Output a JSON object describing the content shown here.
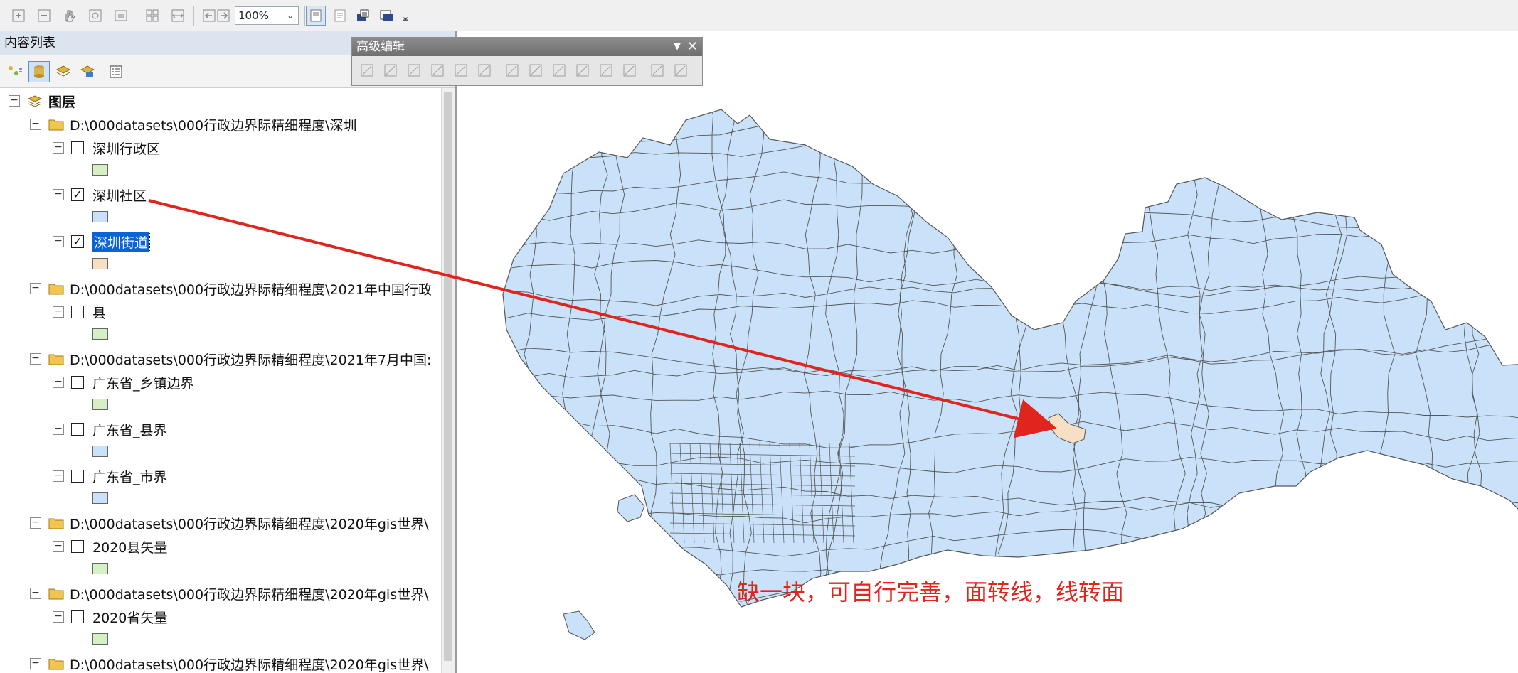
{
  "toolbar": {
    "zoom_value": "100%",
    "buttons": [
      "zoom-in-fixed-icon",
      "zoom-out-fixed-icon",
      "pan-icon",
      "full-extent-icon",
      "fixed-extent-icon",
      "fit-page-icon",
      "fit-width-icon",
      "go-back-icon",
      "go-forward-icon",
      "layout-view-icon",
      "data-view-icon",
      "refresh-icon",
      "print-preview-icon"
    ]
  },
  "toc": {
    "title": "内容列表",
    "tools": [
      "list-by-drawing-order-icon",
      "list-by-source-icon",
      "list-by-visibility-icon",
      "list-by-selection-icon",
      "options-icon"
    ],
    "root_label": "图层",
    "groups": [
      {
        "path": "D:\\000datasets\\000行政边界际精细程度\\深圳",
        "layers": [
          {
            "name": "深圳行政区",
            "checked": false,
            "swatch": "#d4f0c4"
          },
          {
            "name": "深圳社区",
            "checked": true,
            "swatch": "#c9e2f9"
          },
          {
            "name": "深圳街道",
            "checked": true,
            "swatch": "#f7dfc4",
            "selected": true
          }
        ]
      },
      {
        "path": "D:\\000datasets\\000行政边界际精细程度\\2021年中国行政",
        "layers": [
          {
            "name": "县",
            "checked": false,
            "swatch": "#d4f0c4"
          }
        ]
      },
      {
        "path": "D:\\000datasets\\000行政边界际精细程度\\2021年7月中国:",
        "layers": [
          {
            "name": "广东省_乡镇边界",
            "checked": false,
            "swatch": "#d4f0c4"
          },
          {
            "name": "广东省_县界",
            "checked": false,
            "swatch": "#c9e2f9"
          },
          {
            "name": "广东省_市界",
            "checked": false,
            "swatch": "#c9e2f9"
          }
        ]
      },
      {
        "path": "D:\\000datasets\\000行政边界际精细程度\\2020年gis世界\\",
        "layers": [
          {
            "name": "2020县矢量",
            "checked": false,
            "swatch": "#d4f0c4"
          }
        ]
      },
      {
        "path": "D:\\000datasets\\000行政边界际精细程度\\2020年gis世界\\",
        "layers": [
          {
            "name": "2020省矢量",
            "checked": false,
            "swatch": "#d4f0c4"
          }
        ]
      },
      {
        "path": "D:\\000datasets\\000行政边界际精细程度\\2020年gis世界\\",
        "layers": []
      }
    ]
  },
  "advanced_editing": {
    "title": "高级编辑",
    "buttons": [
      "copy-features-icon",
      "fillet-icon",
      "extend-icon",
      "trim-icon",
      "line-intersection-icon",
      "explode-icon",
      "generalize-icon",
      "smooth-icon",
      "rotate-icon",
      "align-edge-icon",
      "distribute-icon",
      "build-polygon-icon",
      "split-polygon-icon",
      "construct-features-icon"
    ]
  },
  "map": {
    "polygon_fill": "#c9e2f9",
    "polygon_stroke": "#555555",
    "highlight_fill": "#f7dfc4",
    "arrow_color": "#e0241e",
    "annotation": "缺一块，可自行完善，面转线，线转面"
  }
}
